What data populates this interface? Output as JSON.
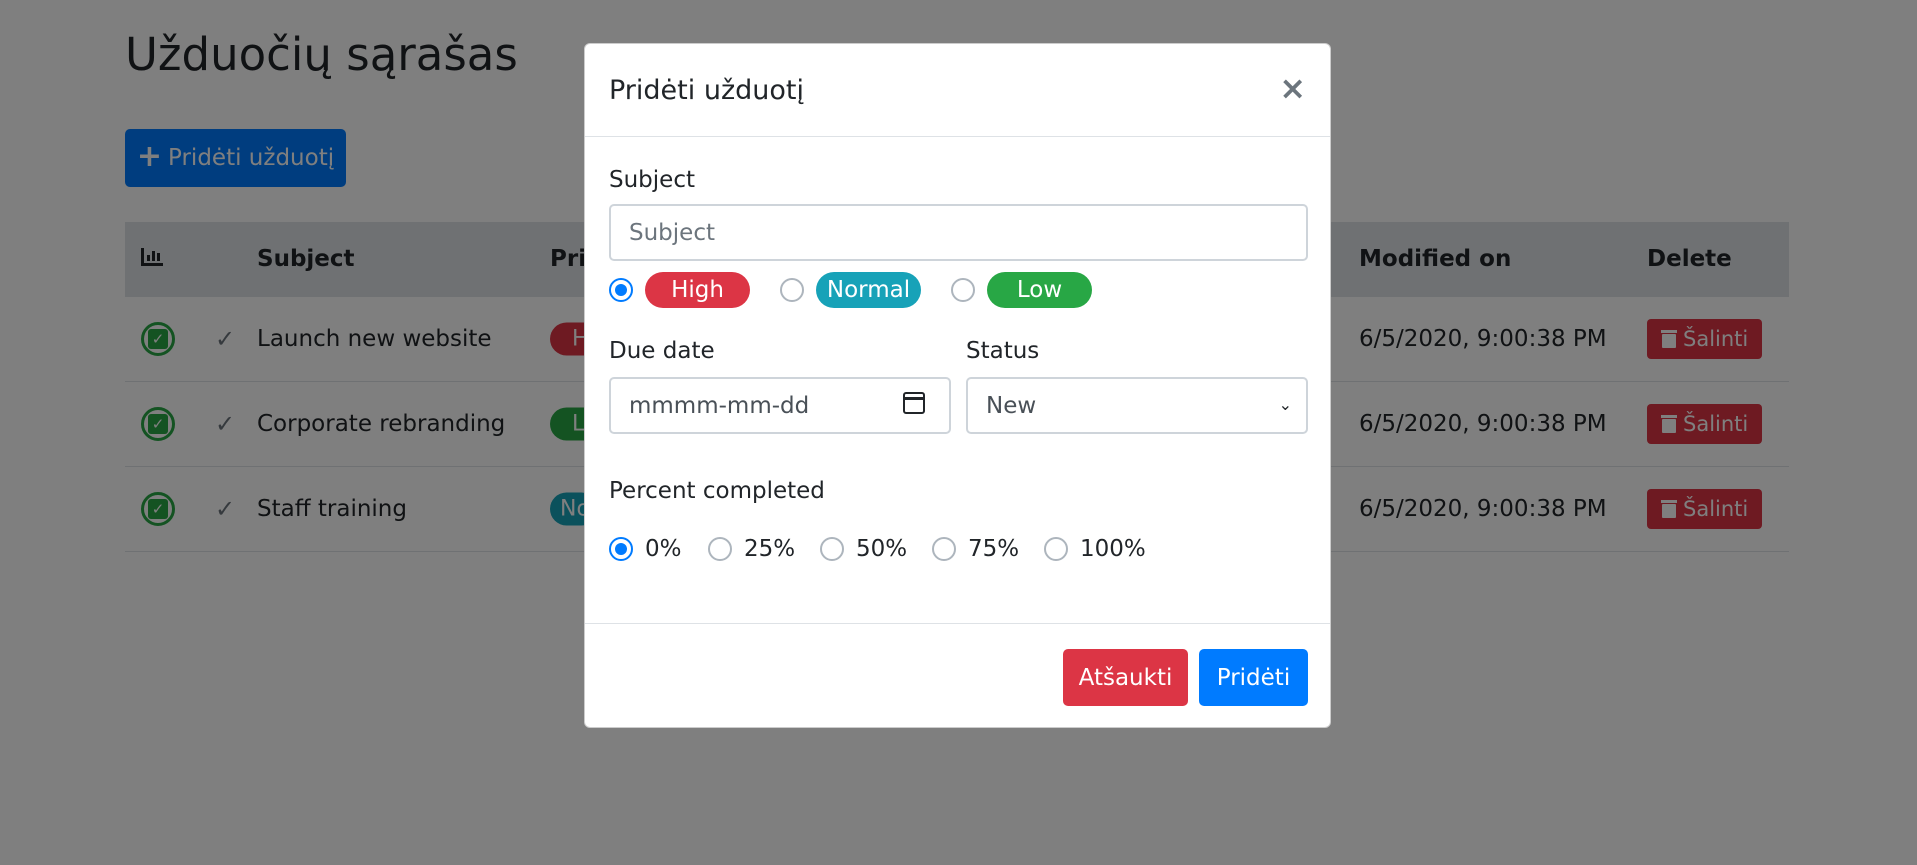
{
  "page": {
    "title": "Užduočių sąrašas",
    "add_button_label": "Pridėti užduotį",
    "table": {
      "headers": {
        "icon": "chart-icon",
        "subject": "Subject",
        "priority": "Pri",
        "modified": "Modified on",
        "delete": "Delete"
      },
      "rows": [
        {
          "subject": "Launch new website",
          "priority": "H",
          "modified": "6/5/2020, 9:00:38 PM",
          "delete_label": "Šalinti"
        },
        {
          "subject": "Corporate rebranding",
          "priority": "L",
          "modified": "6/5/2020, 9:00:38 PM",
          "delete_label": "Šalinti"
        },
        {
          "subject": "Staff training",
          "priority": "No",
          "modified": "6/5/2020, 9:00:38 PM",
          "delete_label": "Šalinti"
        }
      ]
    }
  },
  "modal": {
    "title": "Pridėti užduotį",
    "close_symbol": "×",
    "subject_label": "Subject",
    "subject_placeholder": "Subject",
    "priority_options": [
      "High",
      "Normal",
      "Low"
    ],
    "priority_selected": "High",
    "due_date_label": "Due date",
    "due_date_placeholder": "mmmm-mm-dd",
    "status_label": "Status",
    "status_value": "New",
    "percent_label": "Percent completed",
    "percent_options": [
      "0%",
      "25%",
      "50%",
      "75%",
      "100%"
    ],
    "percent_selected": "0%",
    "cancel_label": "Atšaukti",
    "submit_label": "Pridėti"
  },
  "colors": {
    "primary": "#007bff",
    "danger": "#dc3545",
    "info": "#17a2b8",
    "success": "#28a745"
  }
}
